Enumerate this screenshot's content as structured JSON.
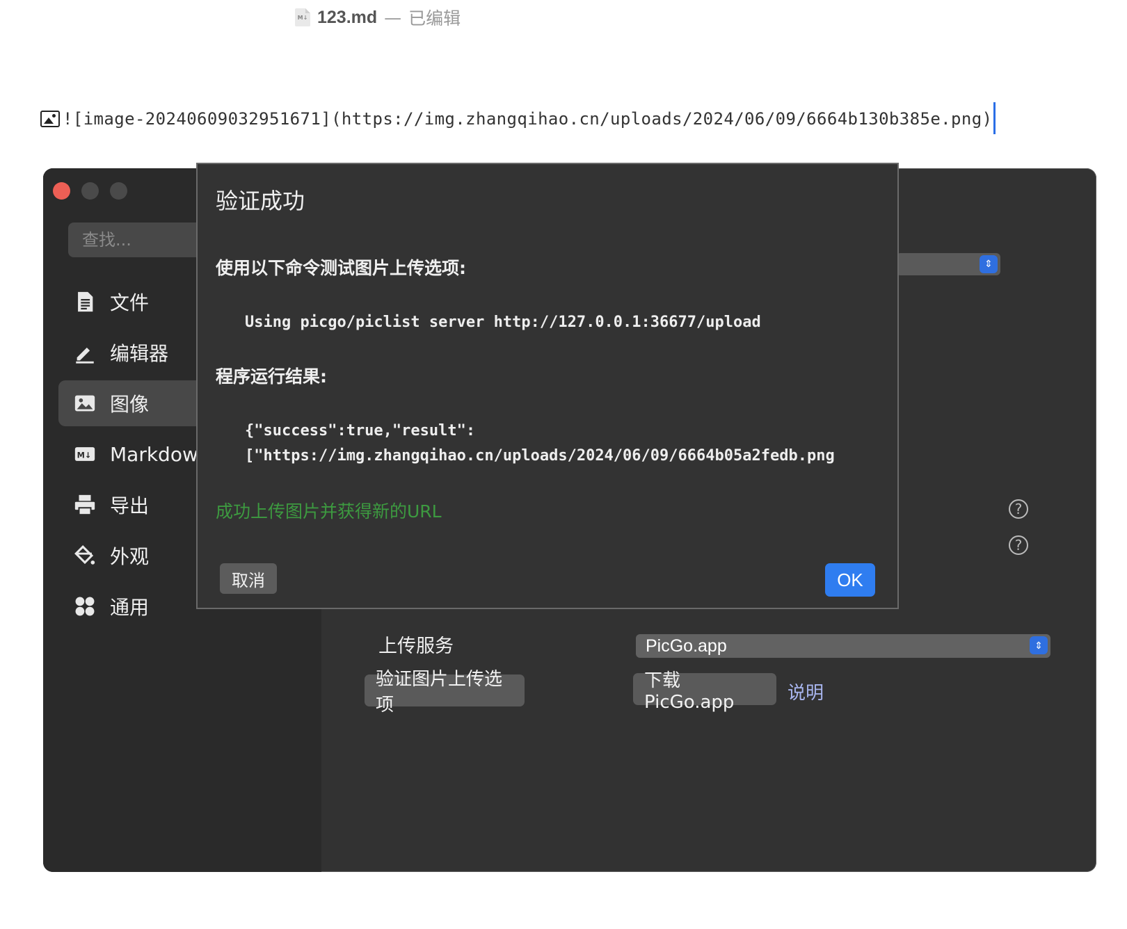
{
  "window": {
    "file_name": "123.md",
    "separator": "—",
    "status": "已编辑",
    "file_icon_label": "M↓"
  },
  "editor": {
    "source_line": "![image-20240609032951671](https://img.zhangqihao.cn/uploads/2024/06/09/6664b130b385e.png)"
  },
  "prefs": {
    "search_placeholder": "查找...",
    "nav": [
      {
        "label": "文件",
        "icon": "file-icon"
      },
      {
        "label": "编辑器",
        "icon": "pencil-icon"
      },
      {
        "label": "图像",
        "icon": "image-icon",
        "active": true
      },
      {
        "label": "Markdown",
        "icon": "markdown-icon"
      },
      {
        "label": "导出",
        "icon": "printer-icon"
      },
      {
        "label": "外观",
        "icon": "paint-bucket-icon"
      },
      {
        "label": "通用",
        "icon": "grid-icon"
      }
    ],
    "upload_service_label": "上传服务",
    "upload_service_value": "PicGo.app",
    "verify_button": "验证图片上传选项",
    "download_button": "下载 PicGo.app",
    "help_link": "说明"
  },
  "dialog": {
    "title": "验证成功",
    "command_label": "使用以下命令测试图片上传选项:",
    "command": "Using picgo/piclist server http://127.0.0.1:36677/upload",
    "result_label": "程序运行结果:",
    "result_line1": "{\"success\":true,\"result\":",
    "result_line2": "[\"https://img.zhangqihao.cn/uploads/2024/06/09/6664b05a2fedb.png",
    "success_message": "成功上传图片并获得新的URL",
    "cancel_button": "取消",
    "ok_button": "OK"
  },
  "colors": {
    "accent_blue": "#2f7df0",
    "success_green": "#3d9a40",
    "close_red": "#ed5f55"
  }
}
